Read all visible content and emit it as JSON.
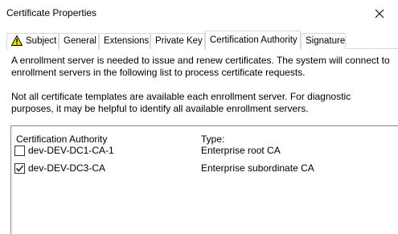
{
  "window": {
    "title": "Certificate Properties",
    "close_icon": "close-icon"
  },
  "tabs": [
    {
      "label": "Subject",
      "icon": "warning-icon",
      "active": false
    },
    {
      "label": "General",
      "active": false
    },
    {
      "label": "Extensions",
      "active": false
    },
    {
      "label": "Private Key",
      "active": false
    },
    {
      "label": "Certification Authority",
      "active": true
    },
    {
      "label": "Signature",
      "active": false
    }
  ],
  "content": {
    "description_1": "A enrollment server is needed to issue and renew certificates. The system will connect to enrollment servers in the following list to process certificate requests.",
    "description_2": "Not all certificate templates are available each enrollment server. For diagnostic purposes, it may be helpful to identify all available enrollment servers."
  },
  "ca_list": {
    "columns": [
      "Certification Authority",
      "Type:"
    ],
    "rows": [
      {
        "name": "dev-DEV-DC1-CA-1",
        "type": "Enterprise root CA",
        "checked": false
      },
      {
        "name": "dev-DEV-DC3-CA",
        "type": "Enterprise subordinate CA",
        "checked": true
      }
    ]
  },
  "colors": {
    "border": "#d9d9d9",
    "list_border": "#828790",
    "warning_fill": "#f5d80c"
  }
}
